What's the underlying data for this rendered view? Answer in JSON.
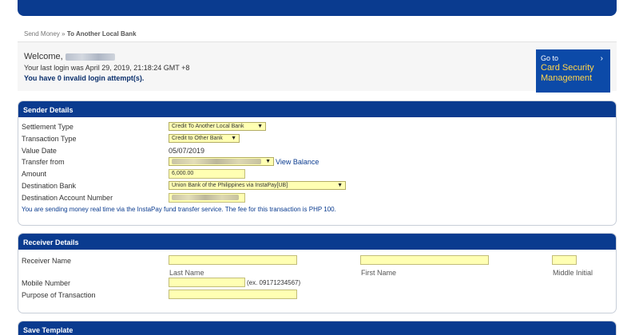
{
  "breadcrumb": {
    "parent": "Send Money",
    "separator": "»",
    "current": "To Another Local Bank"
  },
  "welcome": {
    "greeting": "Welcome,",
    "last_login": "Your last login was April 29, 2019, 21:18:24 GMT +8",
    "invalid_attempts": "You have 0 invalid login attempt(s)."
  },
  "card_security": {
    "goto": "Go to",
    "title_line1": "Card Security",
    "title_line2": "Management"
  },
  "sender": {
    "header": "Sender Details",
    "settlement_type": {
      "label": "Settlement Type",
      "value": "Credit To Another Local Bank"
    },
    "transaction_type": {
      "label": "Transaction Type",
      "value": "Credit to Other Bank"
    },
    "value_date": {
      "label": "Value Date",
      "value": "05/07/2019"
    },
    "transfer_from": {
      "label": "Transfer from",
      "view_balance": "View Balance"
    },
    "amount": {
      "label": "Amount",
      "value": "6,000.00"
    },
    "destination_bank": {
      "label": "Destination Bank",
      "value": "Union Bank of the Philippines via InstaPay[UB]"
    },
    "destination_account": {
      "label": "Destination Account Number",
      "value": ""
    },
    "note": "You are sending money real time via the InstaPay fund transfer service. The fee for this transaction is PHP 100."
  },
  "receiver": {
    "header": "Receiver Details",
    "receiver_name": {
      "label": "Receiver Name",
      "last_name": "Last Name",
      "first_name": "First Name",
      "middle_initial": "Middle Initial"
    },
    "mobile_number": {
      "label": "Mobile Number",
      "hint": "(ex. 09171234567)"
    },
    "purpose": {
      "label": "Purpose of Transaction"
    }
  },
  "save_template": {
    "header": "Save Template"
  },
  "colors": {
    "brand_blue": "#0a3b8f",
    "field_yellow": "#ffffb3",
    "accent_yellow": "#ffd54a"
  }
}
